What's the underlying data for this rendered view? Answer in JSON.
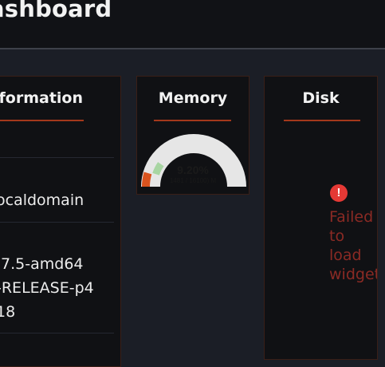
{
  "header": {
    "title": "ashboard"
  },
  "widgets": {
    "information": {
      "title": "formation",
      "lines": [
        "ocaldomain",
        ".7.5-amd64",
        "-RELEASE-p4",
        "18"
      ]
    },
    "memory": {
      "title": "Memory",
      "percent_label": "9.20%",
      "detail_label": "1481 / 16100) M",
      "used_fraction": 0.092,
      "colors": {
        "track": "#e6e6e6",
        "used": "#d9531e",
        "secondary": "#a8d5a2"
      }
    },
    "disk": {
      "title": "Disk",
      "error_icon": "exclamation-circle-icon",
      "error_lines": [
        "Failed",
        "to",
        "load",
        "widget"
      ]
    }
  },
  "colors": {
    "accent": "#a4381b",
    "error": "#e53935"
  }
}
